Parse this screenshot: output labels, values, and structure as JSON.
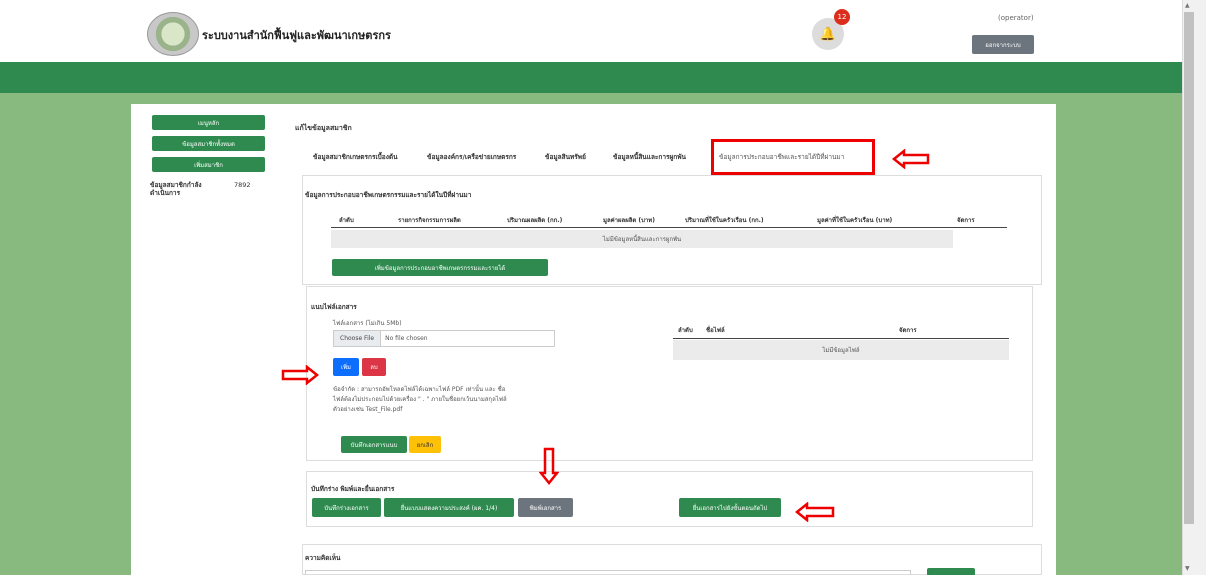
{
  "header": {
    "app_title": "ระบบงานสำนักฟื้นฟูและพัฒนาเกษตรกร",
    "notification_count": "12",
    "user_role": "(operator)",
    "logout_label": "ออกจากระบบ"
  },
  "sidebar": {
    "items": [
      {
        "label": "เมนูหลัก"
      },
      {
        "label": "ข้อมูลสมาชิกทั้งหมด"
      },
      {
        "label": "เพิ่มสมาชิก"
      }
    ],
    "stat_label": "ข้อมูลสมาชิกกำลังดำเนินการ",
    "stat_value": "7892"
  },
  "page_title": "แก้ไขข้อมูลสมาชิก",
  "tabs": [
    {
      "label": "ข้อมูลสมาชิกเกษตรกรเบื้องต้น"
    },
    {
      "label": "ข้อมูลองค์กร/เครือข่ายเกษตรกร"
    },
    {
      "label": "ข้อมูลสินทรัพย์"
    },
    {
      "label": "ข้อมูลหนี้สินและการผูกพัน"
    },
    {
      "label": "ข้อมูลการประกอบอาชีพและรายได้ปีที่ผ่านมา"
    }
  ],
  "occupation": {
    "title": "ข้อมูลการประกอบอาชีพเกษตรกรรมและรายได้ในปีที่ผ่านมา",
    "columns": [
      "ลำดับ",
      "รายการกิจกรรมการผลิต",
      "ปริมาณผลผลิต (กก.)",
      "มูลค่าผลผลิต (บาท)",
      "ปริมาณที่ใช้ในครัวเรือน (กก.)",
      "มูลค่าที่ใช้ในครัวเรือน (บาท)",
      "จัดการ"
    ],
    "empty_text": "ไม่มีข้อมูลหนี้สินและการผูกพัน",
    "add_button": "เพิ่มข้อมูลการประกอบอาชีพเกษตรกรรมและรายได้"
  },
  "attachments": {
    "title": "แนบไฟล์เอกสาร",
    "file_label": "ไฟล์เอกสาร (ไม่เกิน 5Mb)",
    "choose_file": "Choose File",
    "no_file": "No file chosen",
    "add_button": "เพิ่ม",
    "delete_button": "ลบ",
    "note": "ข้อจำกัด : สามารถอัพโหลดไฟล์ได้เฉพาะไฟล์ PDF เท่านั้น และ ชื่อไฟล์ต้องไม่ประกอบไปด้วยเครื่อง \" . \" ภายในชื่อยกเว้นนามสกุลไฟล์ตัวอย่างเช่น Test_File.pdf",
    "save_button": "บันทึกเอกสารแนบ",
    "cancel_button": "ยกเลิก",
    "columns": [
      "ลำดับ",
      "ชื่อไฟล์",
      "จัดการ"
    ],
    "empty_text": "ไม่มีข้อมูลไฟล์"
  },
  "draft": {
    "title": "บันทึกร่าง พิมพ์และยื่นเอกสาร",
    "save_draft": "บันทึกร่างเอกสาร",
    "submit_form": "ยื่นแบบแสดงความประสงค์ (ผค. 1/4)",
    "print": "พิมพ์เอกสาร",
    "submit_next": "ยื่นเอกสารไปยังขั้นตอนถัดไป"
  },
  "comment": {
    "title": "ความคิดเห็น"
  },
  "colors": {
    "primary_green": "#2e8a4e",
    "background_green": "#88b97f",
    "annotation_red": "#e00000"
  }
}
